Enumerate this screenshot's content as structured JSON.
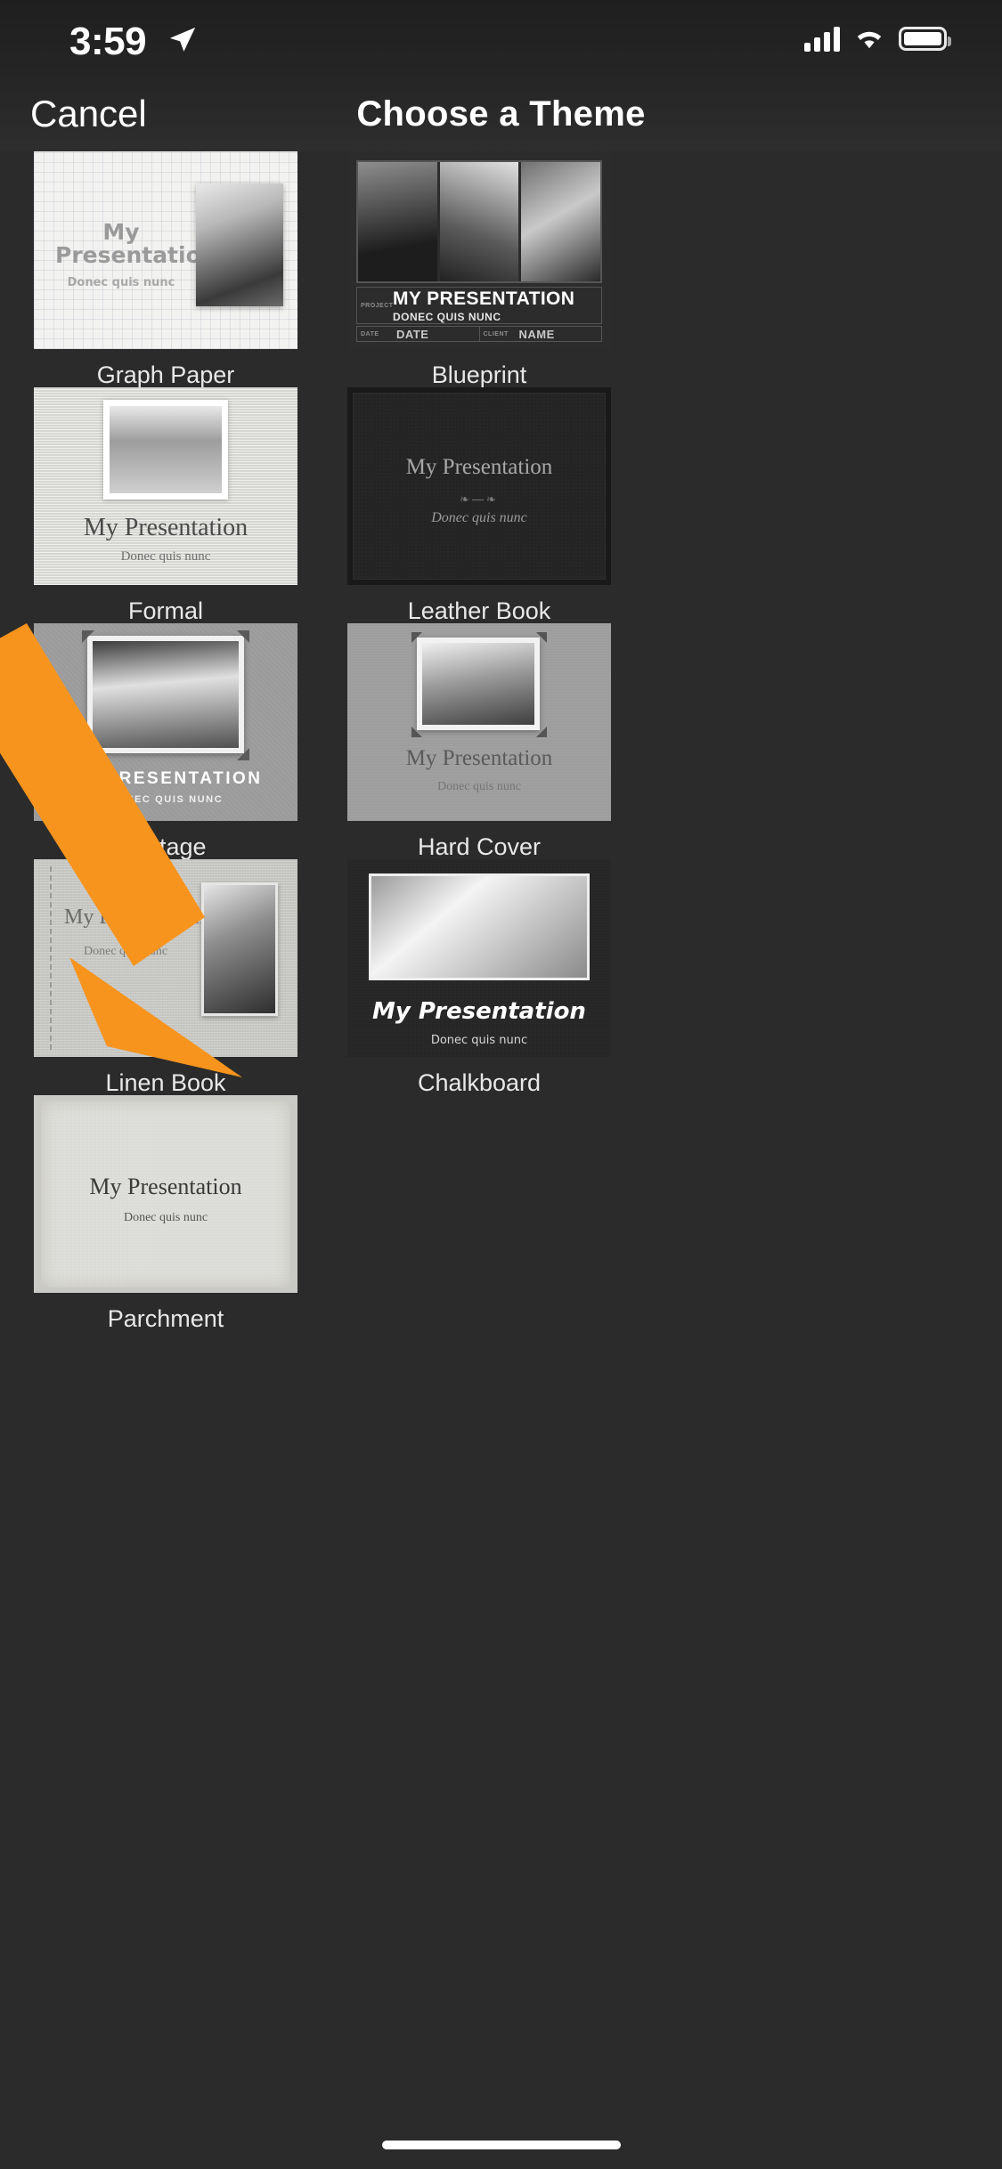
{
  "status_bar": {
    "time": "3:59",
    "location_icon": "location-arrow-icon",
    "signal_icon": "cellular-signal-icon",
    "wifi_icon": "wifi-icon",
    "battery_icon": "battery-icon"
  },
  "nav": {
    "cancel_label": "Cancel",
    "title": "Choose a Theme"
  },
  "common": {
    "title_text": "My Presentation",
    "subtitle_text": "Donec quis nunc",
    "title_caps": "MY PRESENTATION",
    "subtitle_caps": "DONEC QUIS NUNC"
  },
  "blueprint_fields": {
    "project_label": "PROJECT",
    "date_label": "DATE",
    "date_value": "DATE",
    "client_label": "CLIENT",
    "client_value": "NAME"
  },
  "themes": [
    {
      "id": "graph-paper",
      "label": "Graph Paper",
      "title": "My Presentation",
      "subtitle": "Donec quis nunc"
    },
    {
      "id": "blueprint",
      "label": "Blueprint",
      "title": "MY PRESENTATION",
      "subtitle": "DONEC QUIS NUNC"
    },
    {
      "id": "formal",
      "label": "Formal",
      "title": "My Presentation",
      "subtitle": "Donec quis nunc"
    },
    {
      "id": "leather-book",
      "label": "Leather Book",
      "title": "My Presentation",
      "subtitle": "Donec quis nunc"
    },
    {
      "id": "vintage",
      "label": "Vintage",
      "title": "MY PRESENTATION",
      "subtitle": "DONEC QUIS NUNC"
    },
    {
      "id": "hard-cover",
      "label": "Hard Cover",
      "title": "My Presentation",
      "subtitle": "Donec quis nunc"
    },
    {
      "id": "linen-book",
      "label": "Linen Book",
      "title": "My Presentation",
      "subtitle": "Donec quis nunc"
    },
    {
      "id": "chalkboard",
      "label": "Chalkboard",
      "title": "My Presentation",
      "subtitle": "Donec quis nunc"
    },
    {
      "id": "parchment",
      "label": "Parchment",
      "title": "My Presentation",
      "subtitle": "Donec quis nunc"
    }
  ],
  "annotation": {
    "type": "arrow",
    "color": "#F7941E",
    "points_to": "vintage"
  },
  "colors": {
    "background": "#2b2b2b",
    "navbar": "#2e2e2e",
    "text": "#ffffff",
    "caption": "#e8e8e8",
    "accent_arrow": "#F7941E"
  },
  "home_indicator": "home-indicator"
}
